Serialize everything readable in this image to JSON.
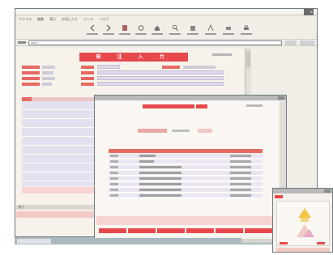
{
  "main_window": {
    "title": "ファイル 編集 表示 お気に入り ツール ヘルプ",
    "menu": [
      "ファイル",
      "編集",
      "表示",
      "お気に入り",
      "ツール",
      "ヘルプ"
    ],
    "toolbar": [
      {
        "icon": "back-icon"
      },
      {
        "icon": "forward-icon"
      },
      {
        "icon": "stop-icon"
      },
      {
        "icon": "refresh-icon"
      },
      {
        "icon": "home-icon"
      },
      {
        "icon": "search-icon"
      },
      {
        "icon": "favorites-icon"
      },
      {
        "icon": "history-icon"
      },
      {
        "icon": "mail-icon"
      },
      {
        "icon": "print-icon"
      }
    ],
    "address": "http://",
    "page_title": "発 注 入 力",
    "status_label": "終了"
  },
  "ordering_window": {
    "header_title": "発注一覧",
    "status_label": "終了",
    "row_count": 8
  },
  "dialog_window": {},
  "taskbar": {
    "start_label": ""
  },
  "colors": {
    "accent_red": "#e7484c",
    "label_red": "#e66a62",
    "lavender": "#e5e0ef",
    "pink": "#f6d4d1",
    "frame": "#a9b9bf"
  }
}
